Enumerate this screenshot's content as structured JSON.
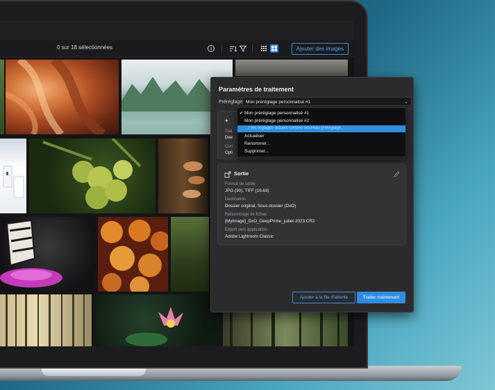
{
  "toolbar": {
    "selection_count": "0 sur 18 sélectionnées",
    "add_images_label": "Ajouter des images",
    "info_icon": "info-icon",
    "sort_icon": "sort-icon",
    "filter_icon": "filter-icon",
    "grid_icon": "grid-icon",
    "tiles_icon": "tiles-icon"
  },
  "panel": {
    "title": "Paramètres de traitement",
    "preset_label": "Préréglage",
    "preset_value": "Mon préréglage personnalisé #1",
    "dropdown": {
      "items": [
        {
          "label": "Mon préréglage personnalisé #1",
          "checked": true
        },
        {
          "label": "Mon préréglage personnalisé #2",
          "checked": false
        }
      ],
      "highlighted": "…r les réglages actuels comme nouveau préréglage...",
      "actions": [
        "Actualiser",
        "Renommer...",
        "Supprimer..."
      ]
    },
    "processing_card": {
      "partial_label_1": "Trai",
      "partial_value_1": "Dee",
      "partial_label_2": "Corr",
      "partial_value_2": "Opti"
    },
    "output_card": {
      "title": "Sortie",
      "fields": [
        {
          "label": "Format de sortie",
          "value": "JPG (90), TIFF (16-bit)"
        },
        {
          "label": "Destination",
          "value": "Dossier original, Sous-dossier (DxO)"
        },
        {
          "label": "Renommage de fichier",
          "value": "{MyImage}_DxO_DeepPrime_juillet-2023.CR2"
        },
        {
          "label": "Export vers application",
          "value": "Adobe Lightroom Classic"
        }
      ]
    },
    "queue_button": "Ajouter à la file d'attente",
    "process_button": "Traiter maintenant"
  },
  "colors": {
    "accent": "#2e8de0",
    "panel_bg": "#2b2b2d",
    "card_bg": "#333336"
  }
}
